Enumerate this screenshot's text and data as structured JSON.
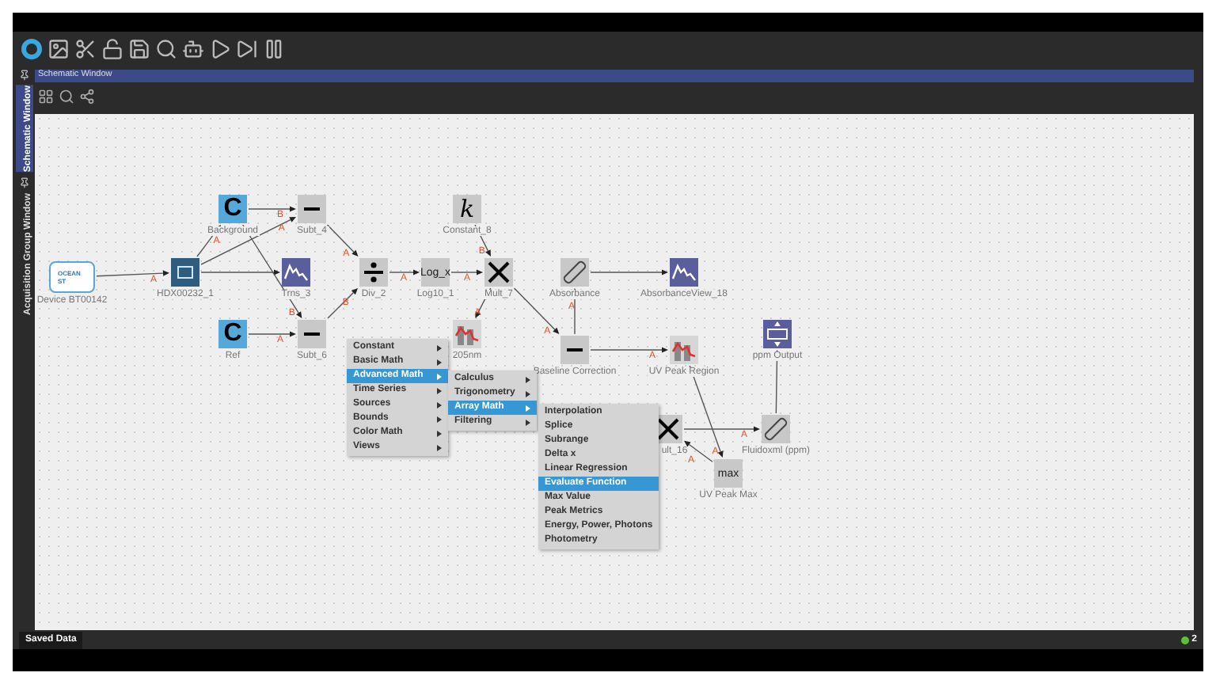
{
  "toolbar_title": "Schematic Window",
  "side_tabs": [
    {
      "label": "Schematic Window",
      "selected": true
    },
    {
      "label": "Acquisition Group Window",
      "selected": false
    }
  ],
  "nodes": [
    {
      "kind": "device",
      "label": "Device BT00142",
      "icon_text": "OCEAN ST"
    },
    {
      "kind": "camera",
      "label": "HDX00232_1"
    },
    {
      "kind": "constant",
      "label": "Background",
      "icon_text": "C"
    },
    {
      "kind": "constant",
      "label": "Ref",
      "icon_text": "C"
    },
    {
      "kind": "subtract",
      "label": "Subt_4"
    },
    {
      "kind": "subtract",
      "label": "Subt_6"
    },
    {
      "kind": "spectrum",
      "label": "Trns_3"
    },
    {
      "kind": "divide",
      "label": "Div_2"
    },
    {
      "kind": "text",
      "label": "Log10_1",
      "icon_text": "Log_x"
    },
    {
      "kind": "constant_k",
      "label": "Constant_8",
      "icon_text": "k"
    },
    {
      "kind": "multiply",
      "label": "Mult_7"
    },
    {
      "kind": "region",
      "label": "205nm"
    },
    {
      "kind": "ruler",
      "label": "Absorbance"
    },
    {
      "kind": "spectrum",
      "label": "AbsorbanceView_18"
    },
    {
      "kind": "subtract",
      "label": "Baseline Correction"
    },
    {
      "kind": "region",
      "label": "UV Peak Region"
    },
    {
      "kind": "output",
      "label": "ppm Output"
    },
    {
      "kind": "multiply",
      "label": "ult_16"
    },
    {
      "kind": "ruler",
      "label": "Fluidoxml (ppm)"
    },
    {
      "kind": "text",
      "label": "UV Peak Max",
      "icon_text": "max"
    }
  ],
  "port_labels": [
    {
      "port": "A"
    },
    {
      "port": "A"
    },
    {
      "port": "A"
    },
    {
      "port": "B"
    },
    {
      "port": "B"
    },
    {
      "port": "A"
    },
    {
      "port": "A"
    },
    {
      "port": "B"
    },
    {
      "port": "A"
    },
    {
      "port": "A"
    },
    {
      "port": "B"
    },
    {
      "port": "A"
    },
    {
      "port": "A"
    },
    {
      "port": "A"
    },
    {
      "port": "A"
    },
    {
      "port": "A"
    },
    {
      "port": "A"
    },
    {
      "port": "A"
    }
  ],
  "menus": [
    {
      "items": [
        {
          "label": "Constant",
          "selected": false
        },
        {
          "label": "Basic Math",
          "selected": false
        },
        {
          "label": "Advanced Math",
          "selected": true
        },
        {
          "label": "Time Series",
          "selected": false
        },
        {
          "label": "Sources",
          "selected": false
        },
        {
          "label": "Bounds",
          "selected": false
        },
        {
          "label": "Color Math",
          "selected": false
        },
        {
          "label": "Views",
          "selected": false
        }
      ]
    },
    {
      "items": [
        {
          "label": "Calculus",
          "selected": false
        },
        {
          "label": "Trigonometry",
          "selected": false
        },
        {
          "label": "Array Math",
          "selected": true
        },
        {
          "label": "Filtering",
          "selected": false
        }
      ]
    },
    {
      "items": [
        {
          "label": "Interpolation",
          "selected": false
        },
        {
          "label": "Splice",
          "selected": false
        },
        {
          "label": "Subrange",
          "selected": false
        },
        {
          "label": "Delta x",
          "selected": false
        },
        {
          "label": "Linear Regression",
          "selected": false
        },
        {
          "label": "Evaluate Function",
          "selected": true
        },
        {
          "label": "Max Value",
          "selected": false
        },
        {
          "label": "Peak Metrics",
          "selected": false
        },
        {
          "label": "Energy, Power, Photons",
          "selected": false
        },
        {
          "label": "Photometry",
          "selected": false
        }
      ]
    }
  ],
  "status_bar": {
    "tab": "Saved Data",
    "count": "2"
  }
}
